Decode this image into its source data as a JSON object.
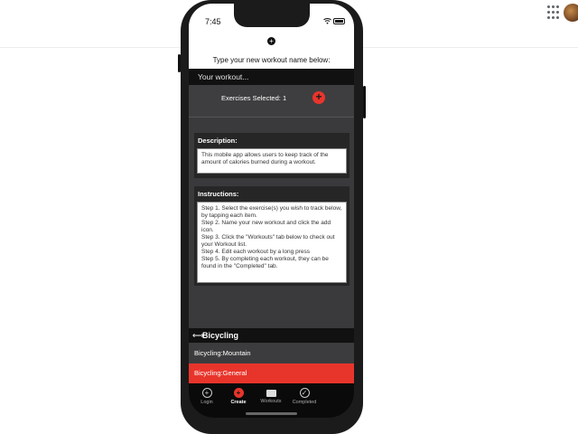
{
  "status": {
    "time": "7:45"
  },
  "header": {
    "add_icon": "+",
    "prompt": "Type your new workout name below:"
  },
  "name_input": {
    "placeholder": "Your workout..."
  },
  "exercises": {
    "label": "Exercises Selected: 1",
    "add_icon": "+"
  },
  "description": {
    "title": "Description:",
    "body": "This mobile app allows users to keep track of the amount of calories burned during a workout."
  },
  "instructions": {
    "title": "Instructions:",
    "steps": [
      "Step 1. Select the exercise(s) you wish to track below, by tapping each item.",
      "Step 2. Name your new workout and click the add icon.",
      "Step 3. Click the \"Workouts\" tab below to check out your Workout list.",
      "Step 4. Edit each workout by a long press",
      "Step 5. By completing each workout, they can be found in the \"Completed\" tab."
    ]
  },
  "list": {
    "header_icon": "⟷",
    "title": "Bicycling",
    "items": [
      {
        "label": "Bicycling:Mountain",
        "selected": false
      },
      {
        "label": "Bicycling:General",
        "selected": true
      }
    ]
  },
  "tabs": {
    "login": {
      "label": "Login",
      "icon": "+"
    },
    "create": {
      "label": "Create",
      "icon": "+"
    },
    "workouts": {
      "label": "Workouts",
      "icon": ""
    },
    "completed": {
      "label": "Completed",
      "icon": "✓"
    }
  },
  "colors": {
    "accent": "#e8352b",
    "background": "#3a3a3c",
    "dark": "#111111"
  }
}
